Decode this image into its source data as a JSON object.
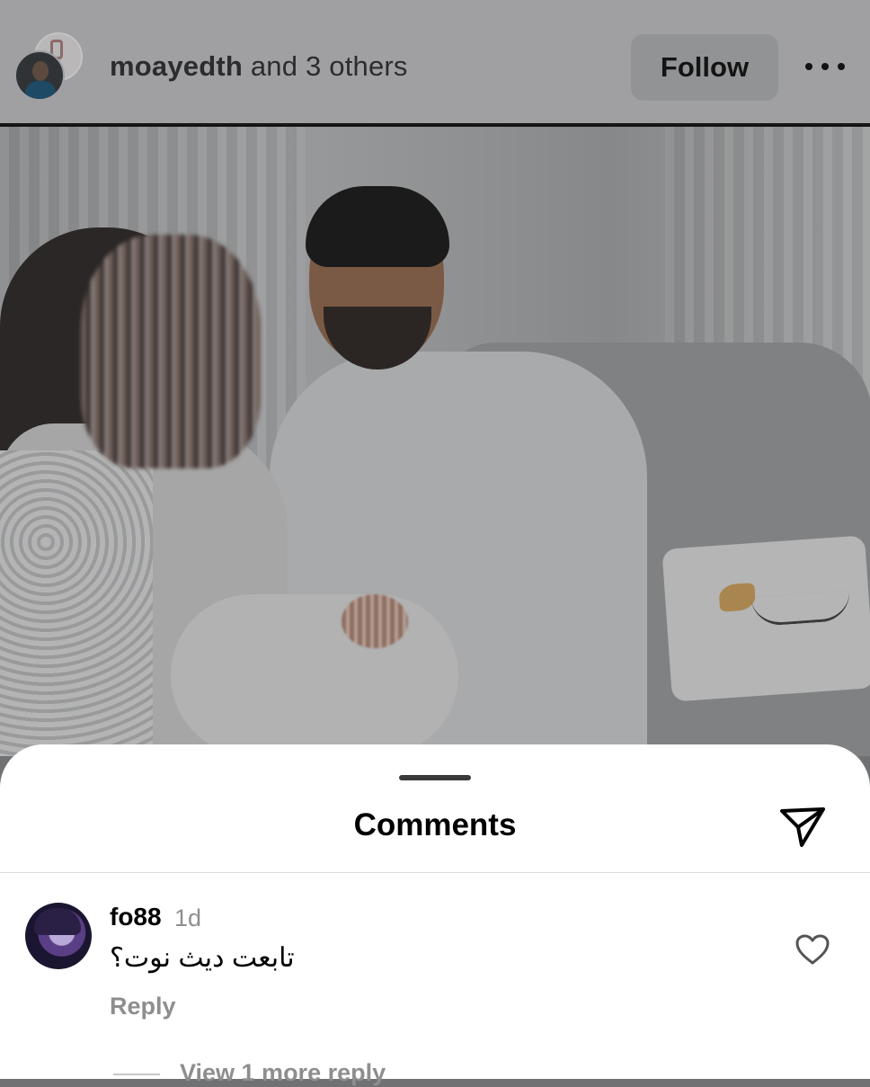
{
  "header": {
    "owner_name": "moayedth",
    "owner_suffix": "and 3 others",
    "follow_label": "Follow",
    "more_icon": "more-horizontal-icon"
  },
  "sheet": {
    "title": "Comments",
    "share_icon": "send-icon"
  },
  "comments": [
    {
      "username": "fo88",
      "time": "1d",
      "text": "تابعت ديث نوت؟",
      "reply_label": "Reply",
      "like_icon": "heart-outline-icon",
      "view_more_label": "View 1 more reply"
    }
  ]
}
